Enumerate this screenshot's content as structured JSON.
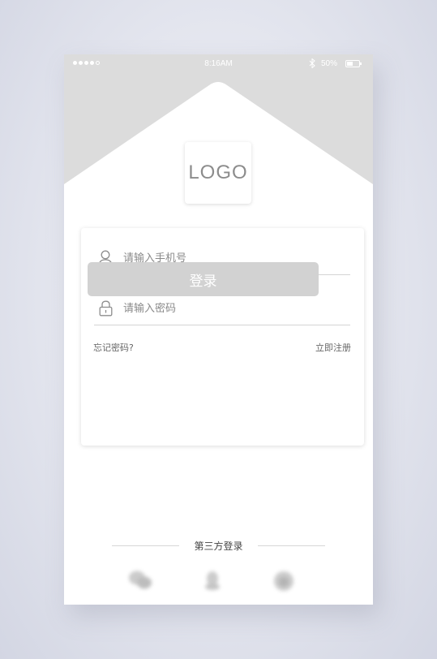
{
  "status_bar": {
    "time": "8:16AM",
    "battery": "50%"
  },
  "logo": {
    "text": "LOGO"
  },
  "login_form": {
    "phone_placeholder": "请输入手机号",
    "password_placeholder": "请输入密码",
    "forgot_password": "忘记密码?",
    "register": "立即注册",
    "login_button": "登录"
  },
  "third_party": {
    "label": "第三方登录",
    "icons": [
      "wechat-icon",
      "qq-icon",
      "weibo-icon"
    ]
  },
  "colors": {
    "header_gray": "#dcdcdc",
    "button_gray": "#d2d2d2",
    "background": "#e3e5ee"
  }
}
